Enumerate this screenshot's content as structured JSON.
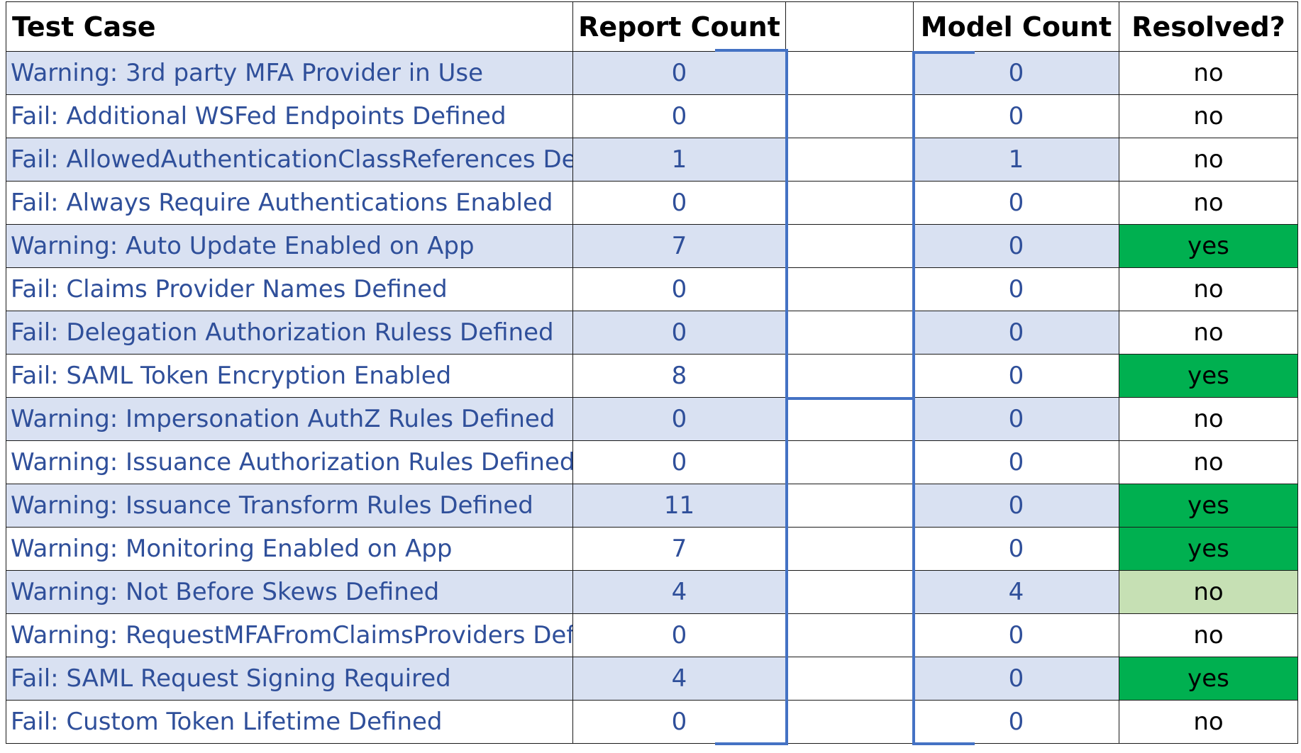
{
  "headers": {
    "test_case": "Test Case",
    "report_count": "Report Count",
    "spacer": "",
    "model_count": "Model Count",
    "resolved": "Resolved?"
  },
  "colors": {
    "text_blue": "#2f4f9a",
    "row_shade": "#d9e1f2",
    "yes_green": "#00b050",
    "light_green": "#c6e0b4",
    "connector_blue": "#4472c4"
  },
  "rows": [
    {
      "test_case": "Warning: 3rd party MFA Provider in Use",
      "report_count": "0",
      "model_count": "0",
      "resolved": "no",
      "resolved_fill": "none"
    },
    {
      "test_case": "Fail: Additional WSFed Endpoints Defined",
      "report_count": "0",
      "model_count": "0",
      "resolved": "no",
      "resolved_fill": "none"
    },
    {
      "test_case": "Fail: AllowedAuthenticationClassReferences Defined",
      "report_count": "1",
      "model_count": "1",
      "resolved": "no",
      "resolved_fill": "none"
    },
    {
      "test_case": "Fail: Always Require Authentications Enabled",
      "report_count": "0",
      "model_count": "0",
      "resolved": "no",
      "resolved_fill": "none"
    },
    {
      "test_case": "Warning: Auto Update Enabled on App",
      "report_count": "7",
      "model_count": "0",
      "resolved": "yes",
      "resolved_fill": "green"
    },
    {
      "test_case": "Fail: Claims Provider Names Defined",
      "report_count": "0",
      "model_count": "0",
      "resolved": "no",
      "resolved_fill": "none"
    },
    {
      "test_case": "Fail: Delegation Authorization Ruless Defined",
      "report_count": "0",
      "model_count": "0",
      "resolved": "no",
      "resolved_fill": "none"
    },
    {
      "test_case": "Fail: SAML Token Encryption Enabled",
      "report_count": "8",
      "model_count": "0",
      "resolved": "yes",
      "resolved_fill": "green"
    },
    {
      "test_case": "Warning: Impersonation AuthZ Rules Defined",
      "report_count": "0",
      "model_count": "0",
      "resolved": "no",
      "resolved_fill": "none"
    },
    {
      "test_case": "Warning: Issuance Authorization Rules Defined",
      "report_count": "0",
      "model_count": "0",
      "resolved": "no",
      "resolved_fill": "none"
    },
    {
      "test_case": "Warning: Issuance Transform Rules Defined",
      "report_count": "11",
      "model_count": "0",
      "resolved": "yes",
      "resolved_fill": "green"
    },
    {
      "test_case": "Warning: Monitoring Enabled on App",
      "report_count": "7",
      "model_count": "0",
      "resolved": "yes",
      "resolved_fill": "green"
    },
    {
      "test_case": "Warning: Not Before Skews Defined",
      "report_count": "4",
      "model_count": "4",
      "resolved": "no",
      "resolved_fill": "lightgreen"
    },
    {
      "test_case": "Warning: RequestMFAFromClaimsProviders Defined",
      "report_count": "0",
      "model_count": "0",
      "resolved": "no",
      "resolved_fill": "none"
    },
    {
      "test_case": "Fail: SAML Request Signing Required",
      "report_count": "4",
      "model_count": "0",
      "resolved": "yes",
      "resolved_fill": "green"
    },
    {
      "test_case": "Fail: Custom Token Lifetime Defined",
      "report_count": "0",
      "model_count": "0",
      "resolved": "no",
      "resolved_fill": "none"
    }
  ]
}
